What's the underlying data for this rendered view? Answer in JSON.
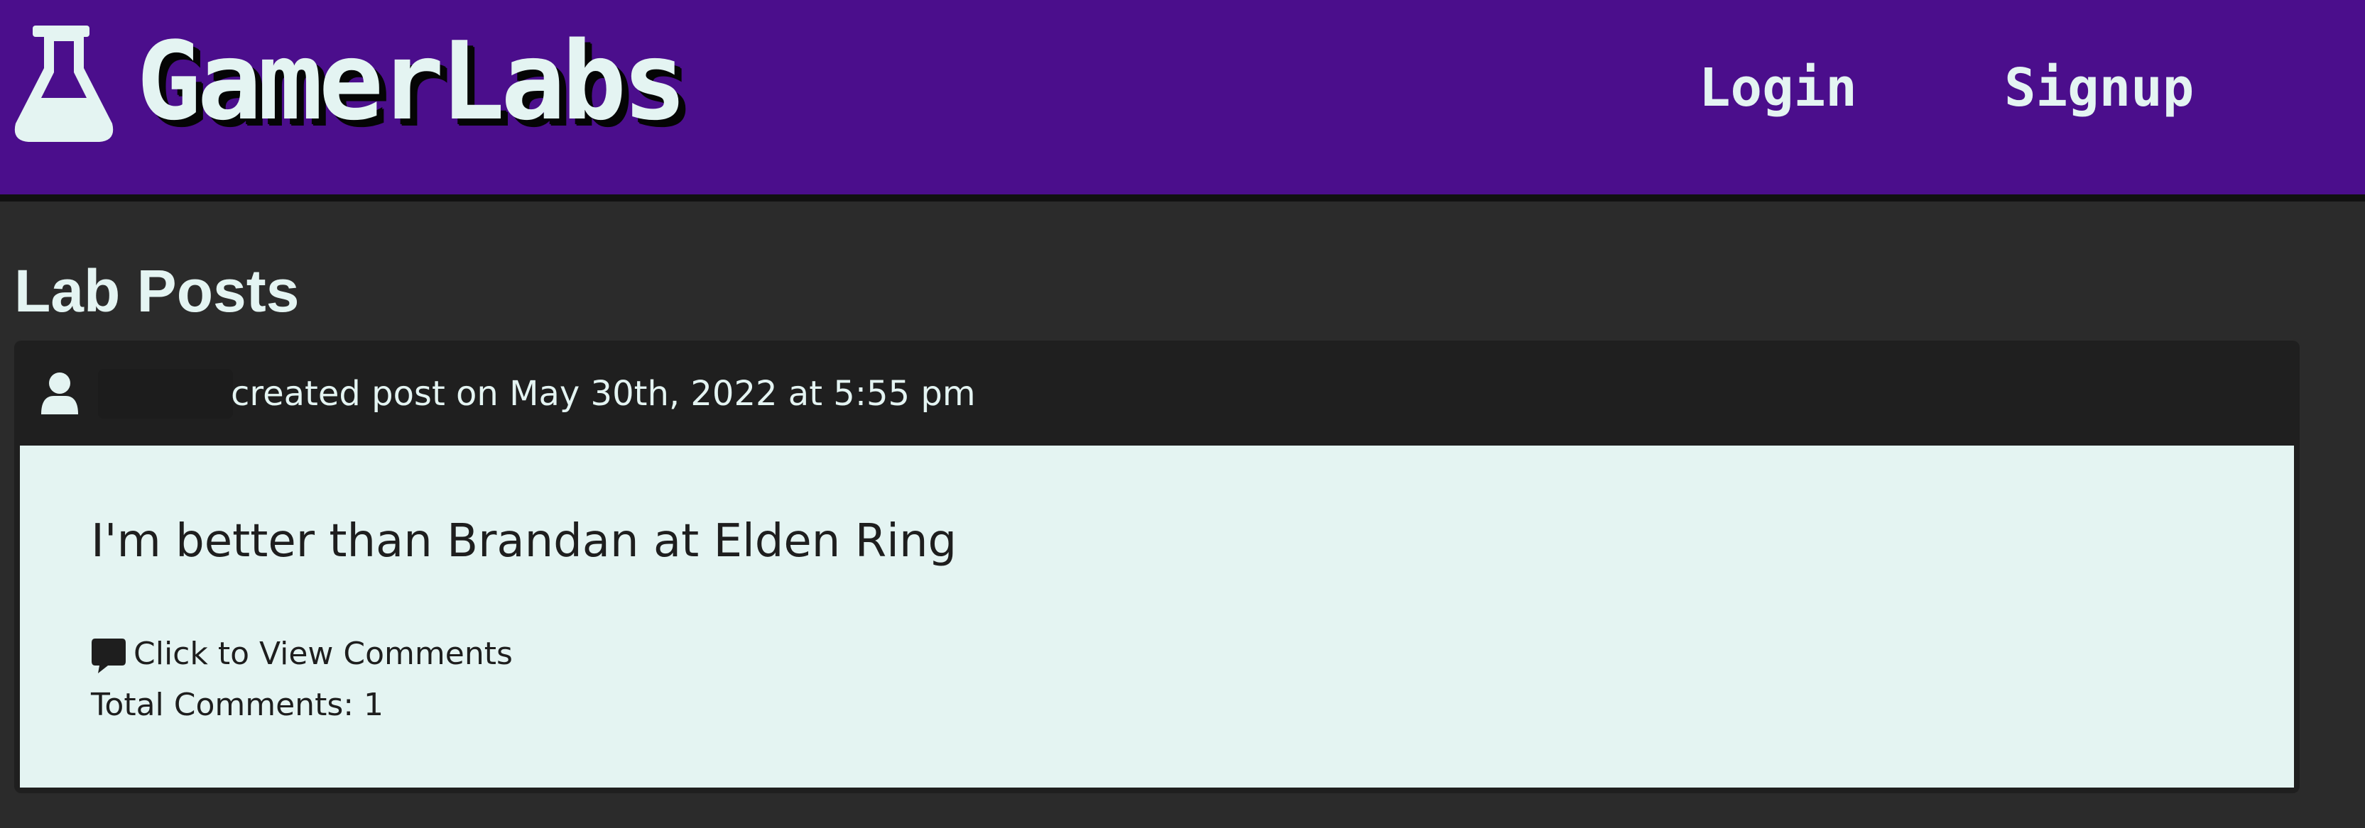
{
  "header": {
    "brand": "GamerLabs",
    "logo_icon": "flask-icon",
    "nav": {
      "login": "Login",
      "signup": "Signup"
    },
    "background_color": "#4b0e8c"
  },
  "main": {
    "heading": "Lab Posts",
    "posts": [
      {
        "user_icon": "user-icon",
        "meta": "created post on May 30th, 2022 at 5:55 pm",
        "content": "I'm better than Brandan at Elden Ring",
        "comments_icon": "comment-icon",
        "comments_link": "Click to View Comments",
        "total_comments": "Total Comments: 1"
      }
    ]
  },
  "colors": {
    "page_background": "#2b2b2b",
    "card_header": "#1f1f1f",
    "card_body": "#e4f4f2",
    "text_light": "#e4f4f2",
    "text_dark": "#1e1e1e"
  }
}
